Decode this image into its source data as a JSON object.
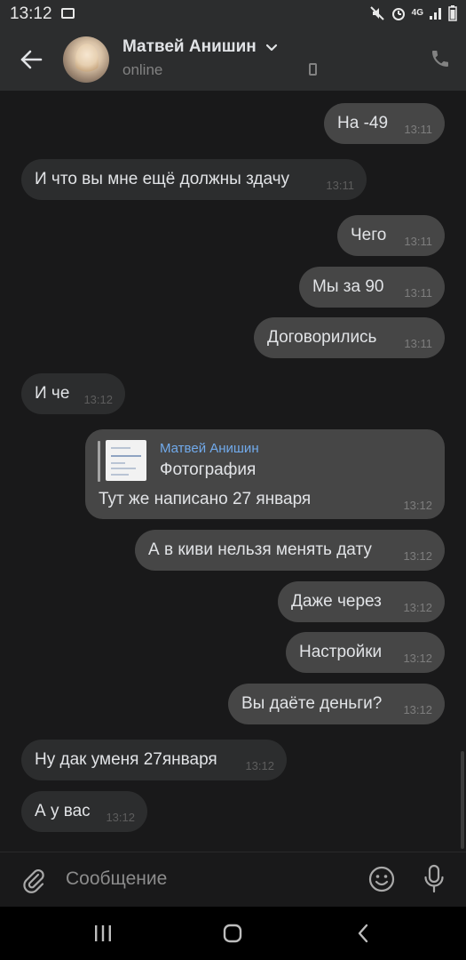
{
  "status_bar": {
    "time": "13:12",
    "network": "4G",
    "icons": [
      "gallery-icon",
      "mute-icon",
      "alarm-icon",
      "network-4g-icon",
      "signal-icon",
      "battery-icon"
    ]
  },
  "header": {
    "contact_name": "Матвей Анишин",
    "status": "online",
    "icons": [
      "back-arrow-icon",
      "chevron-down-icon",
      "phone-device-icon",
      "call-icon"
    ]
  },
  "messages": [
    {
      "dir": "out",
      "text": "На -49",
      "time": "13:11"
    },
    {
      "dir": "in",
      "text": "И что вы мне ещё должны здачу",
      "time": "13:11"
    },
    {
      "dir": "out",
      "text": "Чего",
      "time": "13:11"
    },
    {
      "dir": "out",
      "text": "Мы за 90",
      "time": "13:11"
    },
    {
      "dir": "out",
      "text": "Договорились",
      "time": "13:11"
    },
    {
      "dir": "in",
      "text": "И че",
      "time": "13:12"
    },
    {
      "dir": "out",
      "text": "А в киви нельзя менять дату",
      "time": "13:12"
    },
    {
      "dir": "out",
      "text": "Даже через",
      "time": "13:12"
    },
    {
      "dir": "out",
      "text": "Настройки",
      "time": "13:12"
    },
    {
      "dir": "out",
      "text": "Вы даёте деньги?",
      "time": "13:12"
    },
    {
      "dir": "in",
      "text": "Ну дак уменя 27января",
      "time": "13:12"
    },
    {
      "dir": "in",
      "text": "А у вас",
      "time": "13:12"
    }
  ],
  "forwarded": {
    "author": "Матвей Анишин",
    "kind": "Фотография",
    "text": "Тут же написано 27 января",
    "time": "13:12"
  },
  "composer": {
    "placeholder": "Сообщение",
    "icons": [
      "attach-icon",
      "emoji-icon",
      "microphone-icon"
    ]
  },
  "navbar": {
    "icons": [
      "recent-apps-icon",
      "home-icon",
      "back-icon"
    ]
  },
  "colors": {
    "background": "#19191a",
    "header": "#2c2d2e",
    "bubble_out": "#464646",
    "bubble_in": "#2c2d2e",
    "link": "#71aaeb"
  }
}
